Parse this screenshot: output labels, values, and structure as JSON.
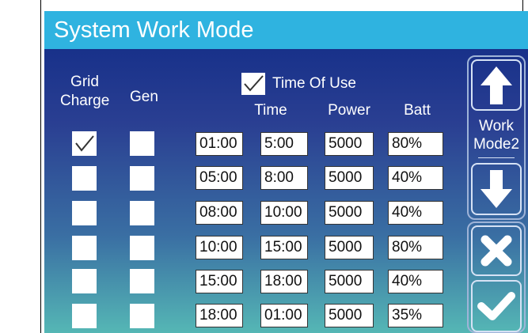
{
  "title": "System Work Mode",
  "headers": {
    "grid_charge_line1": "Grid",
    "grid_charge_line2": "Charge",
    "gen": "Gen",
    "time_of_use": "Time Of Use",
    "time": "Time",
    "power": "Power",
    "batt": "Batt"
  },
  "time_of_use_checked": true,
  "rows": [
    {
      "grid_charge": true,
      "gen": false,
      "start": "01:00",
      "end": "5:00",
      "power": "5000",
      "batt": "80%"
    },
    {
      "grid_charge": false,
      "gen": false,
      "start": "05:00",
      "end": "8:00",
      "power": "5000",
      "batt": "40%"
    },
    {
      "grid_charge": false,
      "gen": false,
      "start": "08:00",
      "end": "10:00",
      "power": "5000",
      "batt": "40%"
    },
    {
      "grid_charge": false,
      "gen": false,
      "start": "10:00",
      "end": "15:00",
      "power": "5000",
      "batt": "80%"
    },
    {
      "grid_charge": false,
      "gen": false,
      "start": "15:00",
      "end": "18:00",
      "power": "5000",
      "batt": "40%"
    },
    {
      "grid_charge": false,
      "gen": false,
      "start": "18:00",
      "end": "01:00",
      "power": "5000",
      "batt": "35%"
    }
  ],
  "side": {
    "work_mode_line1": "Work",
    "work_mode_line2": "Mode2",
    "up_icon": "arrow-up-icon",
    "down_icon": "arrow-down-icon",
    "cancel_icon": "close-icon",
    "confirm_icon": "check-icon"
  },
  "colors": {
    "title_bar": "#2fb3e0",
    "background_top": "#0f2a86",
    "background_bottom": "#55b7b5"
  }
}
